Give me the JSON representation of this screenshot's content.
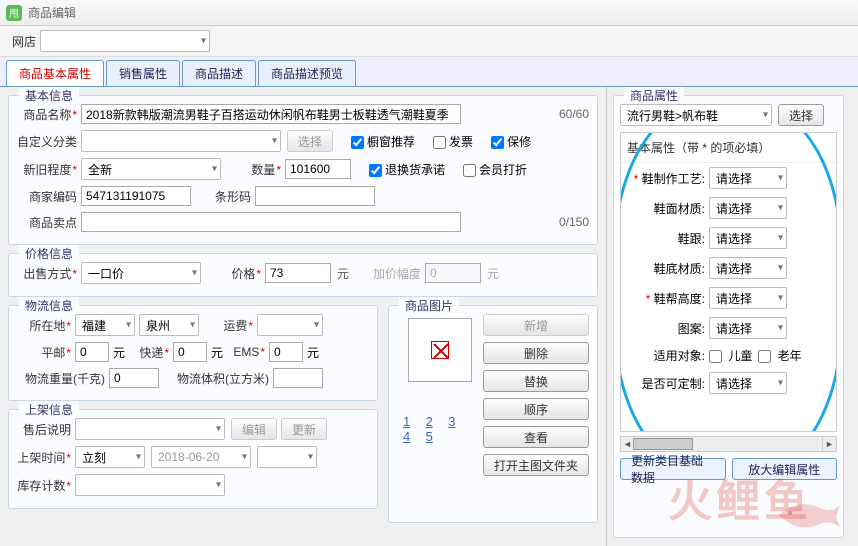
{
  "title": "商品编辑",
  "shop_label": "网店",
  "tabs": [
    "商品基本属性",
    "销售属性",
    "商品描述",
    "商品描述预览"
  ],
  "section_basic": "基本信息",
  "section_price": "价格信息",
  "section_ship": "物流信息",
  "section_shelf": "上架信息",
  "section_img": "商品图片",
  "section_attr": "商品属性",
  "labels": {
    "name": "商品名称",
    "custom_cat": "自定义分类",
    "select": "选择",
    "cond": "新旧程度",
    "qty": "数量",
    "merch_code": "商家编码",
    "barcode": "条形码",
    "sellpoint": "商品卖点",
    "sale_method": "出售方式",
    "price": "价格",
    "yuan": "元",
    "markup": "加价幅度",
    "loc": "所在地",
    "freight": "运费",
    "post": "平邮",
    "express": "快递",
    "ems": "EMS",
    "weight": "物流重量(千克)",
    "volume": "物流体积(立方米)",
    "after_sale": "售后说明",
    "edit": "编辑",
    "update": "更新",
    "shelf_time": "上架时间",
    "stock_count": "库存计数",
    "img_new": "新增",
    "img_del": "删除",
    "img_swap": "替换",
    "img_order": "顺序",
    "img_view": "查看",
    "open_folder": "打开主图文件夹",
    "update_base": "更新类目基础数据",
    "zoom_attr": "放大编辑属性",
    "attr_head": "基本属性（带 * 的项必填）"
  },
  "counters": {
    "name": "60/60",
    "sellpoint": "0/150"
  },
  "values": {
    "product_name": "2018新款韩版潮流男鞋子百搭运动休闲帆布鞋男士板鞋透气潮鞋夏季",
    "cond": "全新",
    "qty": "101600",
    "merch_code": "547131191075",
    "sale_method": "一口价",
    "price": "73",
    "markup": "0",
    "province": "福建",
    "city": "泉州",
    "post": "0",
    "express": "0",
    "ems": "0",
    "weight": "0",
    "shelf_mode": "立刻",
    "shelf_date": "2018-06-20",
    "cat_path": "流行男鞋>帆布鞋"
  },
  "checks": {
    "recommend": "橱窗推荐",
    "invoice": "发票",
    "warranty": "保修",
    "return": "退换货承诺",
    "mdiscount": "会员打折"
  },
  "attrs": [
    {
      "req": true,
      "label": "鞋制作工艺:",
      "value": "请选择"
    },
    {
      "req": false,
      "label": "鞋面材质:",
      "value": "请选择"
    },
    {
      "req": false,
      "label": "鞋跟:",
      "value": "请选择"
    },
    {
      "req": false,
      "label": "鞋底材质:",
      "value": "请选择"
    },
    {
      "req": true,
      "label": "鞋帮高度:",
      "value": "请选择"
    },
    {
      "req": false,
      "label": "图案:",
      "value": "请选择"
    },
    {
      "req": false,
      "label": "适用对象:",
      "value": "",
      "checks": [
        "儿童",
        "老年"
      ]
    },
    {
      "req": false,
      "label": "是否可定制:",
      "value": "请选择"
    }
  ],
  "pages": [
    "1",
    "2",
    "3",
    "4",
    "5"
  ],
  "watermark": "火鲤鱼"
}
